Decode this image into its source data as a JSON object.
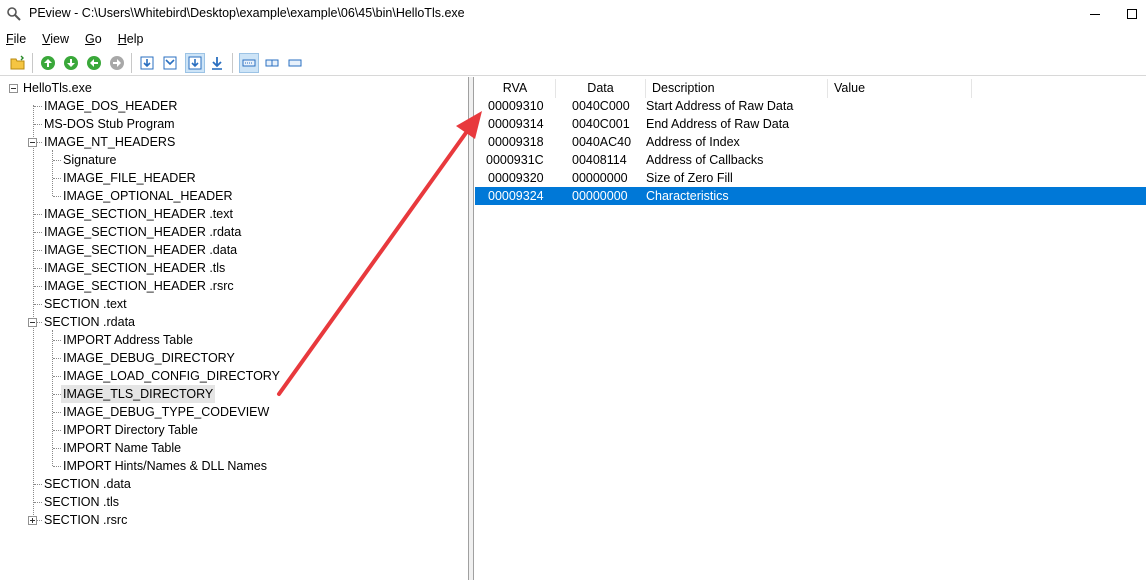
{
  "window": {
    "title": "PEview - C:\\Users\\Whitebird\\Desktop\\example\\example\\06\\45\\bin\\HelloTls.exe"
  },
  "menu": [
    {
      "label": "File"
    },
    {
      "label": "View"
    },
    {
      "label": "Go"
    },
    {
      "label": "Help"
    }
  ],
  "toolbar": {
    "buttons": [
      {
        "icon": "open-folder-icon"
      },
      {
        "icon": "go-up-icon"
      },
      {
        "icon": "go-down-icon"
      },
      {
        "icon": "go-back-icon"
      },
      {
        "icon": "go-forward-icon"
      },
      {
        "icon": "view-byte-icon"
      },
      {
        "icon": "view-word-icon"
      },
      {
        "icon": "view-dword-icon",
        "pressed": true
      },
      {
        "icon": "view-qword-icon"
      },
      {
        "icon": "view-hex-icon",
        "pressed": true
      },
      {
        "icon": "view-text-icon"
      },
      {
        "icon": "view-struct-icon"
      }
    ]
  },
  "tree": {
    "root": "HelloTls.exe",
    "nodes": [
      {
        "label": "IMAGE_DOS_HEADER"
      },
      {
        "label": "MS-DOS Stub Program"
      },
      {
        "label": "IMAGE_NT_HEADERS",
        "expanded": true
      },
      {
        "label": "Signature"
      },
      {
        "label": "IMAGE_FILE_HEADER"
      },
      {
        "label": "IMAGE_OPTIONAL_HEADER"
      },
      {
        "label": "IMAGE_SECTION_HEADER .text"
      },
      {
        "label": "IMAGE_SECTION_HEADER .rdata"
      },
      {
        "label": "IMAGE_SECTION_HEADER .data"
      },
      {
        "label": "IMAGE_SECTION_HEADER .tls"
      },
      {
        "label": "IMAGE_SECTION_HEADER .rsrc"
      },
      {
        "label": "SECTION .text"
      },
      {
        "label": "SECTION .rdata",
        "expanded": true
      },
      {
        "label": "IMPORT Address Table"
      },
      {
        "label": "IMAGE_DEBUG_DIRECTORY"
      },
      {
        "label": "IMAGE_LOAD_CONFIG_DIRECTORY"
      },
      {
        "label": "IMAGE_TLS_DIRECTORY",
        "selected": true
      },
      {
        "label": "IMAGE_DEBUG_TYPE_CODEVIEW"
      },
      {
        "label": "IMPORT Directory Table"
      },
      {
        "label": "IMPORT Name Table"
      },
      {
        "label": "IMPORT Hints/Names & DLL Names"
      },
      {
        "label": "SECTION .data"
      },
      {
        "label": "SECTION .tls"
      },
      {
        "label": "SECTION .rsrc",
        "collapsed": true
      }
    ]
  },
  "list": {
    "columns": [
      "RVA",
      "Data",
      "Description",
      "Value"
    ],
    "rows": [
      {
        "rva": "00009310",
        "data": "0040C000",
        "description": "Start Address of Raw Data",
        "value": ""
      },
      {
        "rva": "00009314",
        "data": "0040C001",
        "description": "End Address of Raw Data",
        "value": ""
      },
      {
        "rva": "00009318",
        "data": "0040AC40",
        "description": "Address of Index",
        "value": ""
      },
      {
        "rva": "0000931C",
        "data": "00408114",
        "description": "Address of Callbacks",
        "value": ""
      },
      {
        "rva": "00009320",
        "data": "00000000",
        "description": "Size of Zero Fill",
        "value": ""
      },
      {
        "rva": "00009324",
        "data": "00000000",
        "description": "Characteristics",
        "value": "",
        "selected": true
      }
    ]
  },
  "colors": {
    "selection": "#0078d7",
    "annotation_arrow": "#e8393d"
  }
}
